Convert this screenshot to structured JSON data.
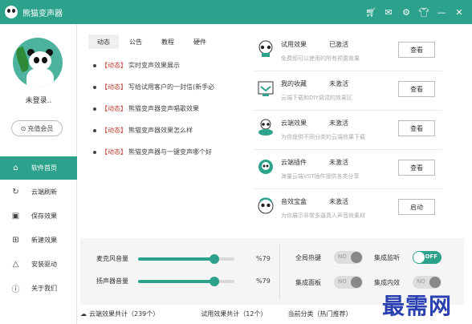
{
  "app": {
    "title": "熊猫变声器",
    "toolbar_icons": [
      "shop-icon",
      "feedback-icon",
      "settings-icon",
      "skin-icon"
    ]
  },
  "user": {
    "status": "未登录..",
    "vip_label": "充值会员"
  },
  "sidebar": {
    "items": [
      {
        "label": "软件首页",
        "icon": "home-icon",
        "active": true
      },
      {
        "label": "云端刷新",
        "icon": "refresh-icon",
        "active": false
      },
      {
        "label": "保存效果",
        "icon": "save-icon",
        "active": false
      },
      {
        "label": "新建效果",
        "icon": "new-icon",
        "active": false
      },
      {
        "label": "安装驱动",
        "icon": "drive-icon",
        "active": false
      },
      {
        "label": "关于我们",
        "icon": "about-icon",
        "active": false
      }
    ]
  },
  "tabs": [
    {
      "label": "动态",
      "active": true
    },
    {
      "label": "公告",
      "active": false
    },
    {
      "label": "教程",
      "active": false
    },
    {
      "label": "硬件",
      "active": false
    }
  ],
  "news": [
    {
      "tag": "【动态】",
      "text": "实时变声效果展示"
    },
    {
      "tag": "【动态】",
      "text": "写给试用客户的一封信(新手必"
    },
    {
      "tag": "【动态】",
      "text": "熊猫变声器变声唱歌效果"
    },
    {
      "tag": "【动态】",
      "text": "熊猫变声器效果怎么样"
    },
    {
      "tag": "【动态】",
      "text": "熊猫变声器与一键变声哪个好"
    }
  ],
  "features": [
    {
      "name": "试用效果",
      "status": "已激活",
      "desc": "免费即可以使用的所有预置效果",
      "button": "查看",
      "icon": "panda-icon"
    },
    {
      "name": "我的收藏",
      "status": "未激活",
      "desc": "云端下载和DIY调试的效果区",
      "button": "查看",
      "icon": "favorites-icon"
    },
    {
      "name": "云端效果",
      "status": "未激活",
      "desc": "为你提供不同分类的云端效果下载",
      "button": "查看",
      "icon": "cloud-icon"
    },
    {
      "name": "云端插件",
      "status": "未激活",
      "desc": "海量云端VST插件提供各类分享",
      "button": "查看",
      "icon": "plugin-icon"
    },
    {
      "name": "音效宝盒",
      "status": "未激活",
      "desc": "为你展示非常多逼真人声音效素材",
      "button": "启动",
      "icon": "soundbox-icon"
    }
  ],
  "sliders": [
    {
      "label": "麦克风音量",
      "value": 79,
      "display": "%79"
    },
    {
      "label": "扬声器音量",
      "value": 79,
      "display": "%79"
    }
  ],
  "toggles": [
    {
      "label": "全局热键",
      "state": "NO",
      "on": false
    },
    {
      "label": "集成监听",
      "state": "OFF",
      "on": true
    },
    {
      "label": "集成面板",
      "state": "NO",
      "on": false
    },
    {
      "label": "集成内效",
      "state": "NO",
      "on": false
    }
  ],
  "status": {
    "cloud_count": "云端效果共计（239个）",
    "trial_count": "试用效果共计（12个）",
    "current_category": "当前分类（热门推荐）"
  },
  "watermark": "最需网",
  "colors": {
    "accent": "#2ca28c",
    "watermark": "#2a3fb0"
  }
}
